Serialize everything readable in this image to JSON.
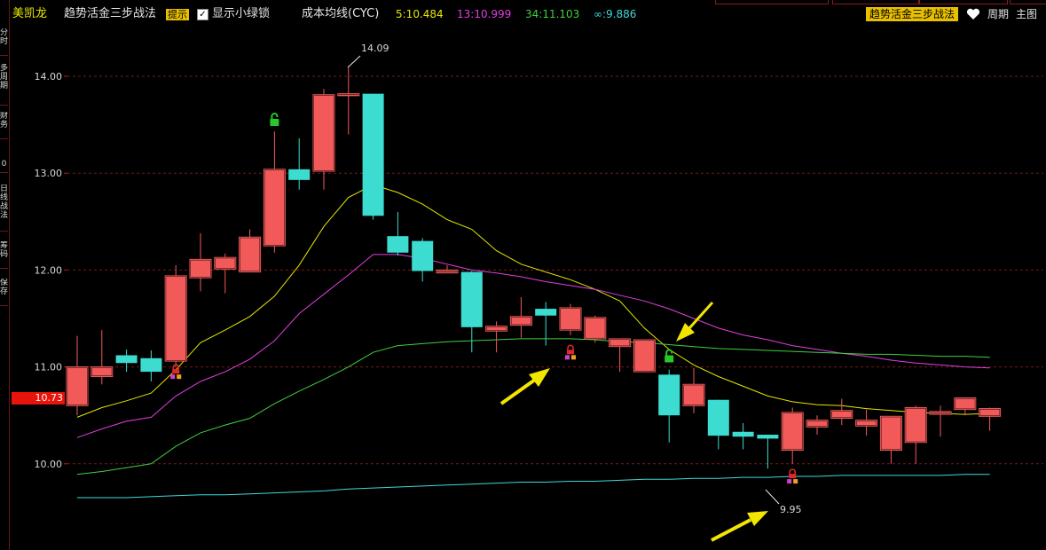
{
  "header": {
    "stock_name": "美凯龙",
    "title": "趋势活金三步战法",
    "hint_label": "提示",
    "lock_checkbox_label": "显示小绿锁",
    "lock_checked": true,
    "indicator_name": "成本均线(CYC)",
    "cyc5": "5:10.484",
    "cyc13": "13:10.999",
    "cyc34": "34:11.103",
    "cycinf": "∞:9.886",
    "strategy_button": "趋势活金三步战法",
    "period_label": "周期",
    "main_label": "主图"
  },
  "left_tabs": [
    "分时",
    "多周期",
    "财务",
    "0",
    "日线战法",
    "筹码",
    "保存"
  ],
  "price_tag": "10.73",
  "colors": {
    "up": "#f25a5a",
    "down": "#3ddcd0",
    "ma5": "#e6e600",
    "ma13": "#e040e0",
    "ma34": "#40d040",
    "mainf": "#40d8d8",
    "arrow": "#f2e600",
    "grid": "#7a1818"
  },
  "chart_data": {
    "type": "candlestick",
    "ylim": [
      9.55,
      14.5
    ],
    "yticks": [
      "14.00",
      "13.00",
      "12.00",
      "11.00",
      "10.00"
    ],
    "high_label": "14.09",
    "low_label": "9.95",
    "candles": [
      {
        "o": 10.6,
        "h": 11.32,
        "l": 10.5,
        "c": 11.0
      },
      {
        "o": 10.9,
        "h": 11.38,
        "l": 10.82,
        "c": 11.0
      },
      {
        "o": 11.12,
        "h": 11.18,
        "l": 10.95,
        "c": 11.04
      },
      {
        "o": 11.09,
        "h": 11.17,
        "l": 10.85,
        "c": 10.95
      },
      {
        "o": 11.06,
        "h": 12.05,
        "l": 11.0,
        "c": 11.94
      },
      {
        "o": 11.92,
        "h": 12.38,
        "l": 11.78,
        "c": 12.11
      },
      {
        "o": 12.01,
        "h": 12.17,
        "l": 11.76,
        "c": 12.13
      },
      {
        "o": 11.98,
        "h": 12.42,
        "l": 11.98,
        "c": 12.34
      },
      {
        "o": 12.25,
        "h": 13.43,
        "l": 12.18,
        "c": 13.04
      },
      {
        "o": 13.04,
        "h": 13.36,
        "l": 12.83,
        "c": 12.93
      },
      {
        "o": 13.02,
        "h": 13.87,
        "l": 12.83,
        "c": 13.81
      },
      {
        "o": 13.8,
        "h": 14.09,
        "l": 13.4,
        "c": 13.82
      },
      {
        "o": 13.82,
        "h": 13.82,
        "l": 12.52,
        "c": 12.56
      },
      {
        "o": 12.35,
        "h": 12.6,
        "l": 12.15,
        "c": 12.18
      },
      {
        "o": 12.3,
        "h": 12.33,
        "l": 11.88,
        "c": 11.99
      },
      {
        "o": 11.97,
        "h": 12.05,
        "l": 11.98,
        "c": 12.0
      },
      {
        "o": 11.98,
        "h": 11.99,
        "l": 11.15,
        "c": 11.41
      },
      {
        "o": 11.37,
        "h": 11.47,
        "l": 11.15,
        "c": 11.42
      },
      {
        "o": 11.43,
        "h": 11.72,
        "l": 11.3,
        "c": 11.52
      },
      {
        "o": 11.6,
        "h": 11.67,
        "l": 11.22,
        "c": 11.53
      },
      {
        "o": 11.38,
        "h": 11.65,
        "l": 11.33,
        "c": 11.61
      },
      {
        "o": 11.29,
        "h": 11.53,
        "l": 11.25,
        "c": 11.51
      },
      {
        "o": 11.21,
        "h": 11.27,
        "l": 10.95,
        "c": 11.29
      },
      {
        "o": 10.95,
        "h": 11.27,
        "l": 10.95,
        "c": 11.28
      },
      {
        "o": 10.92,
        "h": 10.97,
        "l": 10.22,
        "c": 10.5
      },
      {
        "o": 10.6,
        "h": 10.99,
        "l": 10.52,
        "c": 10.82
      },
      {
        "o": 10.66,
        "h": 10.66,
        "l": 10.15,
        "c": 10.29
      },
      {
        "o": 10.33,
        "h": 10.42,
        "l": 10.15,
        "c": 10.28
      },
      {
        "o": 10.3,
        "h": 10.3,
        "l": 9.95,
        "c": 10.26
      },
      {
        "o": 10.14,
        "h": 10.58,
        "l": 10.0,
        "c": 10.53
      },
      {
        "o": 10.38,
        "h": 10.5,
        "l": 10.3,
        "c": 10.45
      },
      {
        "o": 10.47,
        "h": 10.67,
        "l": 10.4,
        "c": 10.55
      },
      {
        "o": 10.39,
        "h": 10.56,
        "l": 10.29,
        "c": 10.45
      },
      {
        "o": 10.14,
        "h": 10.49,
        "l": 10.0,
        "c": 10.49
      },
      {
        "o": 10.22,
        "h": 10.6,
        "l": 10.0,
        "c": 10.58
      },
      {
        "o": 10.51,
        "h": 10.6,
        "l": 10.28,
        "c": 10.54
      },
      {
        "o": 10.56,
        "h": 10.68,
        "l": 10.5,
        "c": 10.68
      },
      {
        "o": 10.49,
        "h": 10.58,
        "l": 10.34,
        "c": 10.57
      }
    ],
    "series": [
      {
        "key": "ma5",
        "values": [
          10.48,
          10.58,
          10.65,
          10.73,
          10.97,
          11.25,
          11.38,
          11.52,
          11.73,
          12.05,
          12.45,
          12.75,
          12.88,
          12.8,
          12.68,
          12.52,
          12.42,
          12.2,
          12.06,
          11.98,
          11.9,
          11.8,
          11.68,
          11.4,
          11.18,
          11.02,
          10.9,
          10.8,
          10.7,
          10.64,
          10.61,
          10.6,
          10.57,
          10.55,
          10.53,
          10.52,
          10.51,
          10.52
        ]
      },
      {
        "key": "ma13",
        "values": [
          10.27,
          10.36,
          10.44,
          10.48,
          10.7,
          10.85,
          10.95,
          11.08,
          11.27,
          11.55,
          11.75,
          11.95,
          12.16,
          12.16,
          12.12,
          12.06,
          12.0,
          11.97,
          11.93,
          11.88,
          11.84,
          11.8,
          11.74,
          11.68,
          11.6,
          11.5,
          11.4,
          11.33,
          11.28,
          11.22,
          11.18,
          11.14,
          11.11,
          11.07,
          11.04,
          11.02,
          11.0,
          10.99
        ]
      },
      {
        "key": "ma34",
        "values": [
          9.89,
          9.92,
          9.96,
          10.0,
          10.18,
          10.32,
          10.4,
          10.47,
          10.62,
          10.75,
          10.87,
          11.0,
          11.15,
          11.22,
          11.24,
          11.26,
          11.27,
          11.28,
          11.29,
          11.29,
          11.29,
          11.28,
          11.26,
          11.25,
          11.23,
          11.21,
          11.19,
          11.18,
          11.17,
          11.16,
          11.15,
          11.14,
          11.13,
          11.13,
          11.12,
          11.11,
          11.11,
          11.1
        ]
      },
      {
        "key": "mainf",
        "values": [
          9.65,
          9.65,
          9.65,
          9.66,
          9.67,
          9.68,
          9.68,
          9.69,
          9.7,
          9.71,
          9.72,
          9.74,
          9.75,
          9.76,
          9.77,
          9.78,
          9.79,
          9.8,
          9.81,
          9.81,
          9.82,
          9.82,
          9.83,
          9.84,
          9.84,
          9.85,
          9.85,
          9.86,
          9.86,
          9.87,
          9.87,
          9.88,
          9.88,
          9.88,
          9.88,
          9.88,
          9.89,
          9.89
        ]
      }
    ],
    "green_locks": [
      {
        "i": 8,
        "price": 13.56
      },
      {
        "i": 24,
        "price": 11.12
      }
    ],
    "red_locks": [
      {
        "i": 4,
        "price": 10.94
      },
      {
        "i": 20,
        "price": 11.14
      },
      {
        "i": 29,
        "price": 9.86
      }
    ]
  }
}
